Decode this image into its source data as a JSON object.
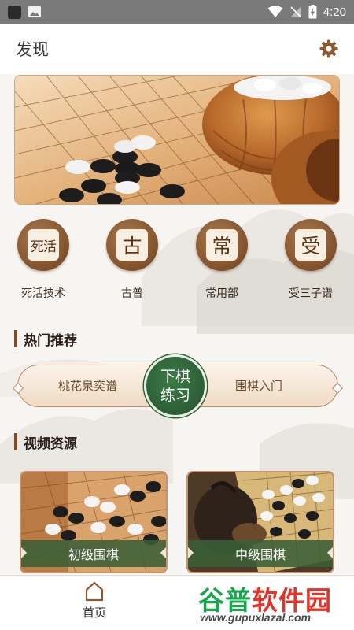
{
  "status_bar": {
    "time": "4:20"
  },
  "header": {
    "title": "发现",
    "settings_icon": "gear-icon"
  },
  "banner": {
    "image": "go-board-with-bowls-photo"
  },
  "categories": [
    {
      "glyph": "死活",
      "label": "死活技术"
    },
    {
      "glyph": "古",
      "label": "古普"
    },
    {
      "glyph": "常",
      "label": "常用部"
    },
    {
      "glyph": "受",
      "label": "受三子谱"
    }
  ],
  "sections": {
    "hot": "热门推荐",
    "video": "视频资源"
  },
  "recommend": {
    "left": "桃花泉奕谱",
    "center": "下棋练习",
    "right": "围棋入门"
  },
  "videos": [
    {
      "label": "初级围棋"
    },
    {
      "label": "中级围棋"
    }
  ],
  "bottom_nav": {
    "home_label": "首页",
    "home_icon": "home-icon"
  },
  "watermark": {
    "text_green": "谷普",
    "text_red": "软件园",
    "url": "www.gupuxlazal.com"
  },
  "colors": {
    "accent_brown": "#8a5a32",
    "accent_green": "#2c5e36",
    "background": "#f7f5f1"
  }
}
